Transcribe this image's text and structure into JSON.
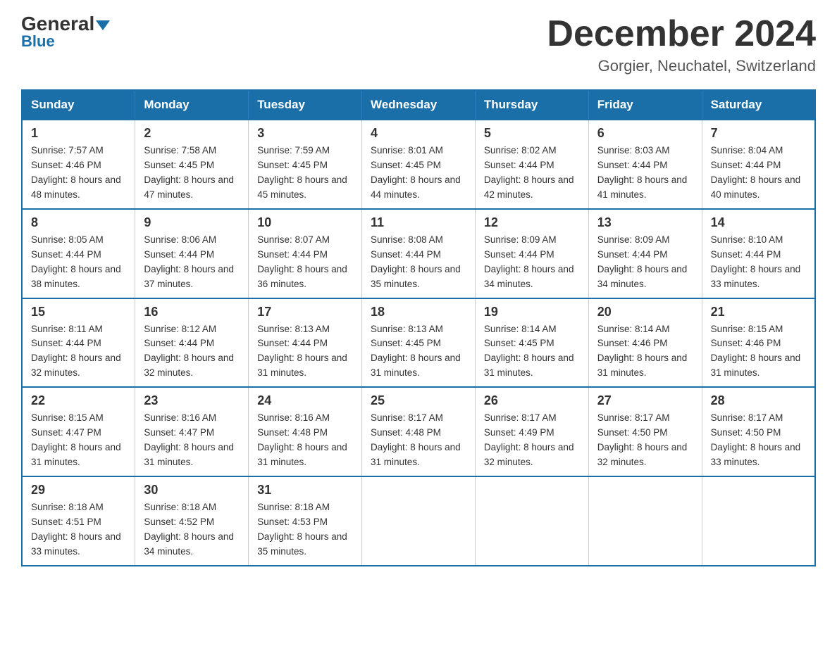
{
  "header": {
    "logo_general": "General",
    "logo_blue": "Blue",
    "title": "December 2024",
    "location": "Gorgier, Neuchatel, Switzerland"
  },
  "weekdays": [
    "Sunday",
    "Monday",
    "Tuesday",
    "Wednesday",
    "Thursday",
    "Friday",
    "Saturday"
  ],
  "weeks": [
    [
      {
        "day": "1",
        "sunrise": "7:57 AM",
        "sunset": "4:46 PM",
        "daylight": "8 hours and 48 minutes."
      },
      {
        "day": "2",
        "sunrise": "7:58 AM",
        "sunset": "4:45 PM",
        "daylight": "8 hours and 47 minutes."
      },
      {
        "day": "3",
        "sunrise": "7:59 AM",
        "sunset": "4:45 PM",
        "daylight": "8 hours and 45 minutes."
      },
      {
        "day": "4",
        "sunrise": "8:01 AM",
        "sunset": "4:45 PM",
        "daylight": "8 hours and 44 minutes."
      },
      {
        "day": "5",
        "sunrise": "8:02 AM",
        "sunset": "4:44 PM",
        "daylight": "8 hours and 42 minutes."
      },
      {
        "day": "6",
        "sunrise": "8:03 AM",
        "sunset": "4:44 PM",
        "daylight": "8 hours and 41 minutes."
      },
      {
        "day": "7",
        "sunrise": "8:04 AM",
        "sunset": "4:44 PM",
        "daylight": "8 hours and 40 minutes."
      }
    ],
    [
      {
        "day": "8",
        "sunrise": "8:05 AM",
        "sunset": "4:44 PM",
        "daylight": "8 hours and 38 minutes."
      },
      {
        "day": "9",
        "sunrise": "8:06 AM",
        "sunset": "4:44 PM",
        "daylight": "8 hours and 37 minutes."
      },
      {
        "day": "10",
        "sunrise": "8:07 AM",
        "sunset": "4:44 PM",
        "daylight": "8 hours and 36 minutes."
      },
      {
        "day": "11",
        "sunrise": "8:08 AM",
        "sunset": "4:44 PM",
        "daylight": "8 hours and 35 minutes."
      },
      {
        "day": "12",
        "sunrise": "8:09 AM",
        "sunset": "4:44 PM",
        "daylight": "8 hours and 34 minutes."
      },
      {
        "day": "13",
        "sunrise": "8:09 AM",
        "sunset": "4:44 PM",
        "daylight": "8 hours and 34 minutes."
      },
      {
        "day": "14",
        "sunrise": "8:10 AM",
        "sunset": "4:44 PM",
        "daylight": "8 hours and 33 minutes."
      }
    ],
    [
      {
        "day": "15",
        "sunrise": "8:11 AM",
        "sunset": "4:44 PM",
        "daylight": "8 hours and 32 minutes."
      },
      {
        "day": "16",
        "sunrise": "8:12 AM",
        "sunset": "4:44 PM",
        "daylight": "8 hours and 32 minutes."
      },
      {
        "day": "17",
        "sunrise": "8:13 AM",
        "sunset": "4:44 PM",
        "daylight": "8 hours and 31 minutes."
      },
      {
        "day": "18",
        "sunrise": "8:13 AM",
        "sunset": "4:45 PM",
        "daylight": "8 hours and 31 minutes."
      },
      {
        "day": "19",
        "sunrise": "8:14 AM",
        "sunset": "4:45 PM",
        "daylight": "8 hours and 31 minutes."
      },
      {
        "day": "20",
        "sunrise": "8:14 AM",
        "sunset": "4:46 PM",
        "daylight": "8 hours and 31 minutes."
      },
      {
        "day": "21",
        "sunrise": "8:15 AM",
        "sunset": "4:46 PM",
        "daylight": "8 hours and 31 minutes."
      }
    ],
    [
      {
        "day": "22",
        "sunrise": "8:15 AM",
        "sunset": "4:47 PM",
        "daylight": "8 hours and 31 minutes."
      },
      {
        "day": "23",
        "sunrise": "8:16 AM",
        "sunset": "4:47 PM",
        "daylight": "8 hours and 31 minutes."
      },
      {
        "day": "24",
        "sunrise": "8:16 AM",
        "sunset": "4:48 PM",
        "daylight": "8 hours and 31 minutes."
      },
      {
        "day": "25",
        "sunrise": "8:17 AM",
        "sunset": "4:48 PM",
        "daylight": "8 hours and 31 minutes."
      },
      {
        "day": "26",
        "sunrise": "8:17 AM",
        "sunset": "4:49 PM",
        "daylight": "8 hours and 32 minutes."
      },
      {
        "day": "27",
        "sunrise": "8:17 AM",
        "sunset": "4:50 PM",
        "daylight": "8 hours and 32 minutes."
      },
      {
        "day": "28",
        "sunrise": "8:17 AM",
        "sunset": "4:50 PM",
        "daylight": "8 hours and 33 minutes."
      }
    ],
    [
      {
        "day": "29",
        "sunrise": "8:18 AM",
        "sunset": "4:51 PM",
        "daylight": "8 hours and 33 minutes."
      },
      {
        "day": "30",
        "sunrise": "8:18 AM",
        "sunset": "4:52 PM",
        "daylight": "8 hours and 34 minutes."
      },
      {
        "day": "31",
        "sunrise": "8:18 AM",
        "sunset": "4:53 PM",
        "daylight": "8 hours and 35 minutes."
      },
      null,
      null,
      null,
      null
    ]
  ]
}
